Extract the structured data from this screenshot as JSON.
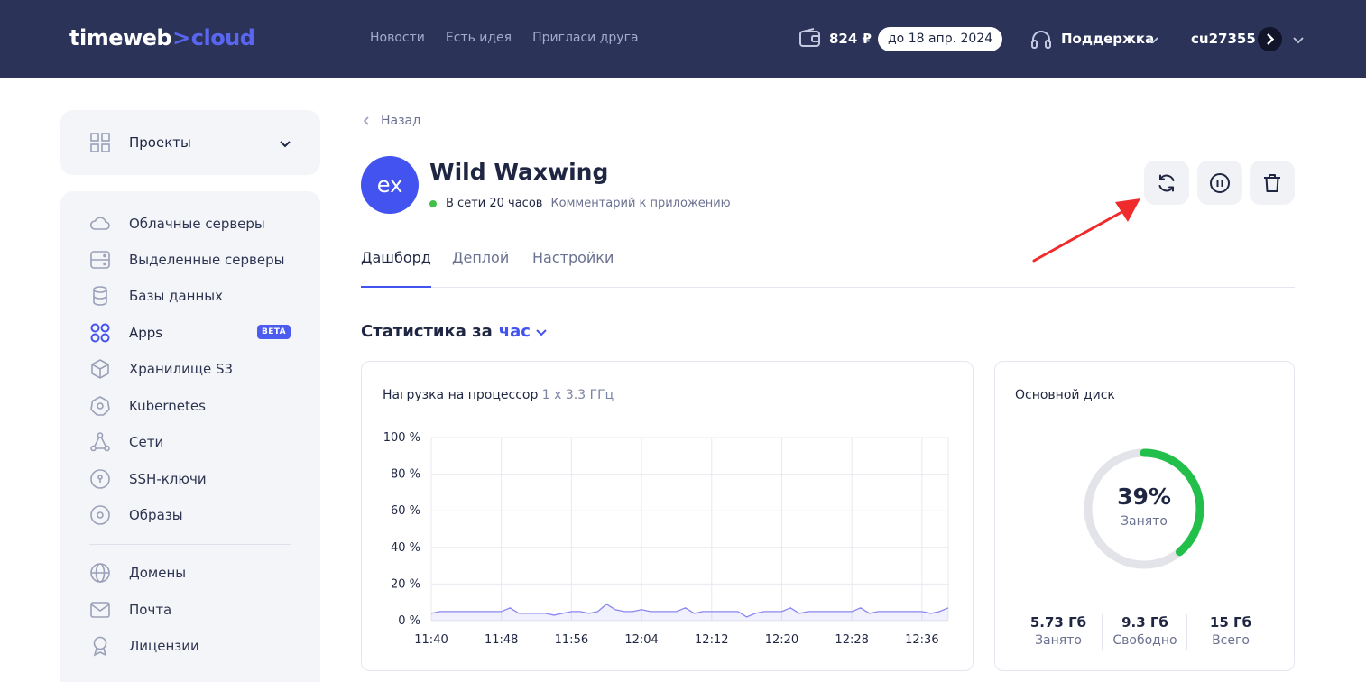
{
  "header": {
    "logo_main": "timeweb",
    "logo_chevron": ">",
    "logo_cloud": "cloud",
    "nav": [
      "Новости",
      "Есть идея",
      "Пригласи друга"
    ],
    "balance": "824 ₽",
    "paid_until": "до 18 апр. 2024",
    "support_label": "Поддержка",
    "username": "cu27355"
  },
  "sidebar": {
    "projects_label": "Проекты",
    "items": [
      {
        "label": "Облачные серверы",
        "icon": "cloud-icon"
      },
      {
        "label": "Выделенные серверы",
        "icon": "server-icon"
      },
      {
        "label": "Базы данных",
        "icon": "database-icon"
      },
      {
        "label": "Apps",
        "icon": "apps-icon",
        "badge": "BETA"
      },
      {
        "label": "Хранилище S3",
        "icon": "cube-icon"
      },
      {
        "label": "Kubernetes",
        "icon": "kubernetes-icon"
      },
      {
        "label": "Сети",
        "icon": "network-icon"
      },
      {
        "label": "SSH-ключи",
        "icon": "key-icon"
      },
      {
        "label": "Образы",
        "icon": "disc-icon"
      },
      {
        "label": "Домены",
        "icon": "globe-icon"
      },
      {
        "label": "Почта",
        "icon": "mail-icon"
      },
      {
        "label": "Лицензии",
        "icon": "license-icon"
      }
    ]
  },
  "main": {
    "back_label": "Назад",
    "avatar_text": "ex",
    "app_title": "Wild Waxwing",
    "status_text": "В сети 20 часов",
    "comment_link": "Комментарий к приложению",
    "tabs": [
      "Дашборд",
      "Деплой",
      "Настройки"
    ],
    "stats_title": "Статистика за",
    "stats_period": "час"
  },
  "cpu": {
    "title": "Нагрузка на процессор",
    "spec": "1 x 3.3 ГГц"
  },
  "disk": {
    "title": "Основной диск",
    "percent": "39%",
    "percent_label": "Занято",
    "used_fraction": 0.39,
    "used_value": "5.73 Гб",
    "used_label": "Занято",
    "free_value": "9.3 Гб",
    "free_label": "Свободно",
    "total_value": "15 Гб",
    "total_label": "Всего"
  },
  "colors": {
    "header_bg": "#2b3358",
    "accent": "#4353f0",
    "disk_used": "#22c04a",
    "disk_track": "#e3e4e9",
    "cpu_line": "#8a86f0",
    "online": "#3fc14a"
  },
  "chart_data": {
    "type": "area",
    "title": "Нагрузка на процессор",
    "subtitle": "1 x 3.3 ГГц",
    "xlabel": "",
    "ylabel": "",
    "x_ticks": [
      "11:40",
      "11:48",
      "11:56",
      "12:04",
      "12:12",
      "12:20",
      "12:28",
      "12:36"
    ],
    "y_ticks": [
      "100 %",
      "80 %",
      "60 %",
      "40 %",
      "20 %",
      "0 %"
    ],
    "ylim": [
      0,
      100
    ],
    "xlim_minutes": [
      0,
      59
    ],
    "grid": true,
    "series": [
      {
        "x": [
          0,
          1,
          2,
          3,
          4,
          5,
          6,
          7,
          8,
          9,
          10,
          11,
          12,
          13,
          14,
          15,
          16,
          17,
          18,
          19,
          20,
          21,
          22,
          23,
          24,
          25,
          26,
          27,
          28,
          29,
          30,
          31,
          32,
          33,
          34,
          35,
          36,
          37,
          38,
          39,
          40,
          41,
          42,
          43,
          44,
          45,
          46,
          47,
          48,
          49,
          50,
          51,
          52,
          53,
          54,
          55,
          56,
          57,
          58,
          59
        ],
        "y": [
          4,
          5,
          5,
          5,
          5,
          5,
          5,
          5,
          5,
          7,
          4,
          4,
          4,
          4,
          3,
          4,
          5,
          5,
          4,
          5,
          9,
          6,
          5,
          5,
          6,
          5,
          5,
          5,
          5,
          7,
          4,
          5,
          5,
          5,
          5,
          5,
          2,
          4,
          5,
          5,
          5,
          7,
          4,
          5,
          5,
          5,
          5,
          5,
          5,
          7,
          4,
          5,
          5,
          5,
          5,
          5,
          5,
          4,
          5,
          7
        ]
      }
    ]
  }
}
